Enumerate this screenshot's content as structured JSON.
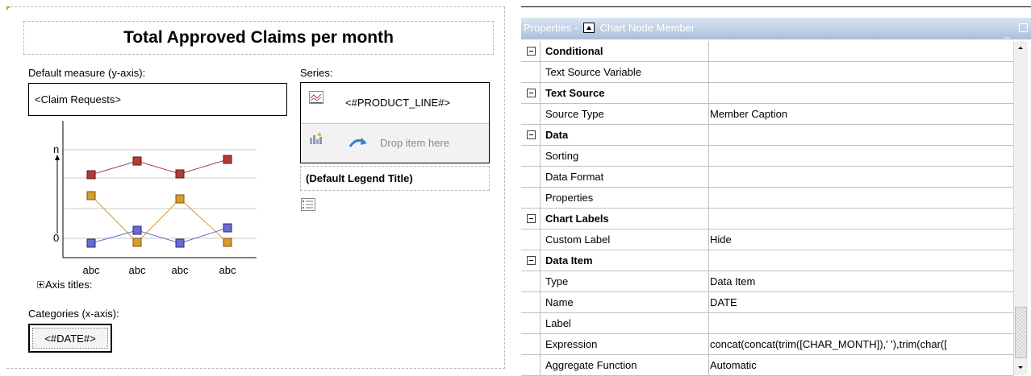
{
  "canvas": {
    "chart_title": "Total Approved Claims per month",
    "measure_label": "Default measure (y-axis):",
    "measure_value": "<Claim Requests>",
    "series_label": "Series:",
    "series_item": "<#PRODUCT_LINE#>",
    "series_drop_text": "Drop item here",
    "legend_title": "(Default Legend Title)",
    "axis_titles_label": "Axis titles:",
    "categories_label": "Categories (x-axis):",
    "categories_value": "<#DATE#>",
    "preview_chart": {
      "y_top_label": "n",
      "y_bottom_label": "0",
      "x_labels": [
        "abc",
        "abc",
        "abc",
        "abc"
      ],
      "colors": {
        "red": "#b23b3b",
        "orange": "#d99a2e",
        "blue": "#6a6ad0"
      }
    }
  },
  "properties": {
    "title_prefix": "Properties -",
    "title_object": "Chart Node Member",
    "minimize_glyph": "_",
    "rows": [
      {
        "kind": "category",
        "name": "Conditional",
        "value": ""
      },
      {
        "kind": "prop",
        "name": "Text Source Variable",
        "value": ""
      },
      {
        "kind": "category",
        "name": "Text Source",
        "value": ""
      },
      {
        "kind": "prop",
        "name": "Source Type",
        "value": "Member Caption"
      },
      {
        "kind": "category",
        "name": "Data",
        "value": ""
      },
      {
        "kind": "prop",
        "name": "Sorting",
        "value": ""
      },
      {
        "kind": "prop",
        "name": "Data Format",
        "value": ""
      },
      {
        "kind": "prop",
        "name": "Properties",
        "value": ""
      },
      {
        "kind": "category",
        "name": "Chart Labels",
        "value": ""
      },
      {
        "kind": "prop",
        "name": "Custom Label",
        "value": "Hide"
      },
      {
        "kind": "category",
        "name": "Data Item",
        "value": ""
      },
      {
        "kind": "prop",
        "name": "Type",
        "value": "Data Item"
      },
      {
        "kind": "prop",
        "name": "Name",
        "value": "DATE"
      },
      {
        "kind": "prop",
        "name": "Label",
        "value": ""
      },
      {
        "kind": "prop",
        "name": "Expression",
        "value": "concat(concat(trim([CHAR_MONTH]),' '),trim(char(["
      },
      {
        "kind": "prop",
        "name": "Aggregate Function",
        "value": "Automatic"
      }
    ]
  }
}
